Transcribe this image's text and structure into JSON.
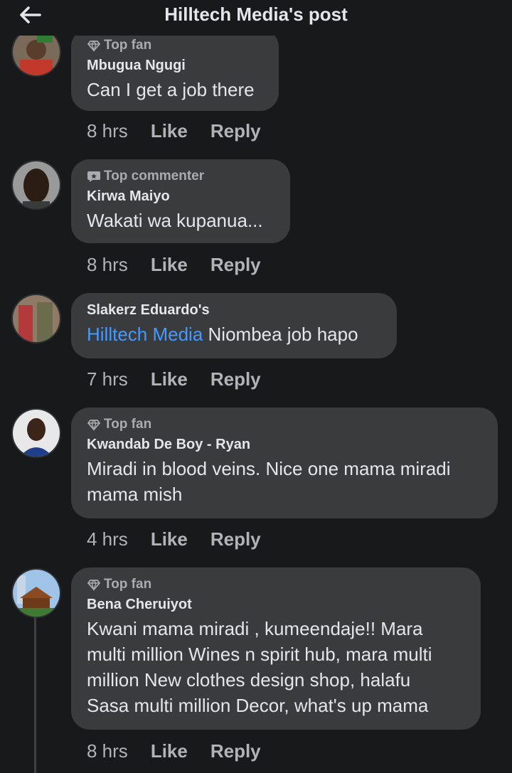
{
  "header": {
    "title": "Hilltech Media's post"
  },
  "comments": [
    {
      "badge": "Top fan",
      "author": "Mbugua Ngugi",
      "text": "Can I get a job there",
      "time": "8 hrs",
      "like": "Like",
      "reply": "Reply"
    },
    {
      "badge": "Top commenter",
      "author": "Kirwa Maiyo",
      "text": "Wakati wa kupanua...",
      "time": "8 hrs",
      "like": "Like",
      "reply": "Reply"
    },
    {
      "author": "Slakerz Eduardo's",
      "mention": "Hilltech Media",
      "text": " Niombea job hapo",
      "time": "7 hrs",
      "like": "Like",
      "reply": "Reply"
    },
    {
      "badge": "Top fan",
      "author": "Kwandab De Boy - Ryan",
      "text_lines": [
        "Miradi in blood veins. Nice one mama miradi",
        "mama mish"
      ],
      "time": "4 hrs",
      "like": "Like",
      "reply": "Reply"
    },
    {
      "badge": "Top fan",
      "author": "Bena Cheruiyot",
      "text_lines": [
        "Kwani mama miradi , kumeendaje!! Mara",
        "multi million Wines n spirit hub, mara multi",
        "million New clothes design shop, halafu",
        "Sasa multi million Decor, what's up mama"
      ],
      "time": "8 hrs",
      "like": "Like",
      "reply": "Reply"
    }
  ]
}
